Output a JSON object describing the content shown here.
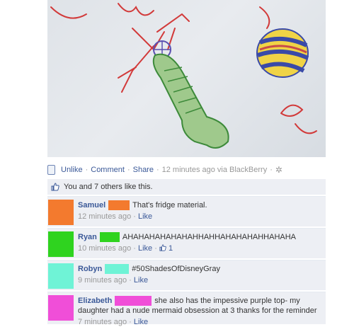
{
  "actions": {
    "unlike": "Unlike",
    "comment": "Comment",
    "share": "Share",
    "timestamp": "12 minutes ago via BlackBerry",
    "dot": "·"
  },
  "likes": {
    "text": "You and 7 others like this."
  },
  "comments": [
    {
      "author": "Samuel",
      "text": "That's fridge material.",
      "time": "12 minutes ago",
      "like": "Like",
      "avatar_color": "#f37a2e",
      "swatch_color": "#f37a2e",
      "like_count": ""
    },
    {
      "author": "Ryan",
      "text": "AHAHAHAHAHAHAHHAHHAHAHAHAHHAHAHA",
      "time": "10 minutes ago",
      "like": "Like",
      "avatar_color": "#2fd31f",
      "swatch_color": "#2fd31f",
      "like_count": "1"
    },
    {
      "author": "Robyn",
      "text": "#50ShadesOfDisneyGray",
      "time": "9 minutes ago",
      "like": "Like",
      "avatar_color": "#6ff3d6",
      "swatch_color": "#6ff3d6",
      "like_count": ""
    },
    {
      "author": "Elizabeth",
      "text_line1": "she also has the impessive purple top- my",
      "text_line2": "daughter had a nude mermaid obsession at 3 thanks for the reminder",
      "time": "7 minutes ago",
      "like": "Like",
      "avatar_color": "#f04ed8",
      "swatch_color": "#f04ed8",
      "like_count": ""
    }
  ]
}
